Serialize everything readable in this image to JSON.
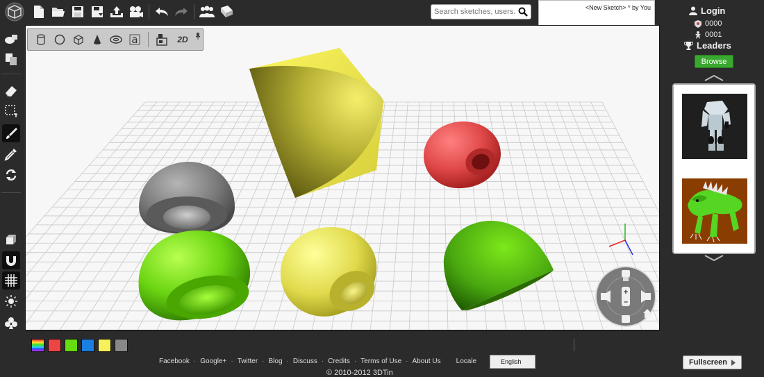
{
  "app": {
    "name": "3DTin"
  },
  "toolbar": {
    "buttons": [
      {
        "name": "new-file-icon",
        "title": "New"
      },
      {
        "name": "open-folder-icon",
        "title": "Open"
      },
      {
        "name": "save-icon",
        "title": "Save"
      },
      {
        "name": "save-as-icon",
        "title": "Save As"
      },
      {
        "name": "upload-icon",
        "title": "Export"
      },
      {
        "name": "camera-icon",
        "title": "Record"
      },
      {
        "name": "undo-icon",
        "title": "Undo"
      },
      {
        "name": "redo-icon",
        "title": "Redo"
      },
      {
        "name": "community-icon",
        "title": "Community"
      },
      {
        "name": "book-icon",
        "title": "Help"
      }
    ]
  },
  "search": {
    "placeholder": "Search sketches, users..."
  },
  "sketch": {
    "title": "<New Sketch>",
    "modified_marker": "*",
    "byline": "by You"
  },
  "user": {
    "login_label": "Login",
    "stat_1": "0000",
    "stat_2": "0001",
    "leaders_label": "Leaders",
    "browse_label": "Browse"
  },
  "shape_toolbar": {
    "items": [
      "cylinder-icon",
      "sphere-icon",
      "cube-icon",
      "cone-icon",
      "torus-icon",
      "text-icon",
      "extrude-icon"
    ],
    "mode_2d": "2D"
  },
  "palette": {
    "colors": [
      "#ee4444",
      "#66dd11",
      "#1a7fe0",
      "#f6f05a",
      "#888888"
    ]
  },
  "footer": {
    "links": [
      "Facebook",
      "Google+",
      "Twitter",
      "Blog",
      "Discuss",
      "Credits",
      "Terms of Use",
      "About Us"
    ],
    "locale_label": "Locale",
    "locale_value": "English",
    "copyright": "© 2010-2012 3DTin",
    "fullscreen_label": "Fullscreen"
  }
}
